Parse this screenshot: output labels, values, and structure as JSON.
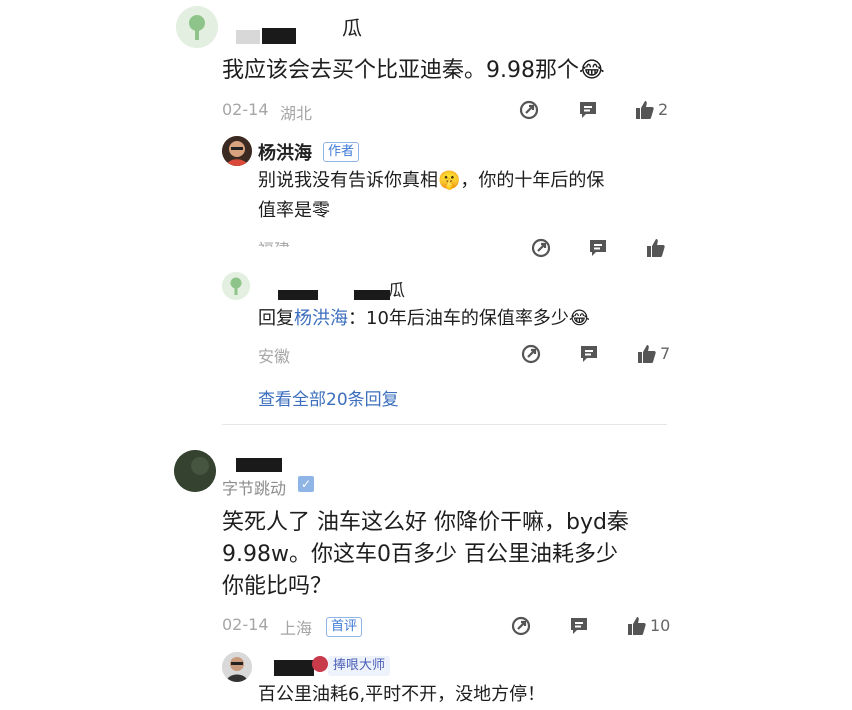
{
  "comments": [
    {
      "name_tail": "瓜",
      "text": "我应该会去买个比亚迪秦。9.98那个😂",
      "date": "02-14",
      "location": "湖北",
      "likes": "2",
      "replies": [
        {
          "name": "杨洪海",
          "badge": "作者",
          "text_line1": "别说我没有告诉你真相🤫，你的十年后的保",
          "text_line2": "值率是零",
          "location": "福建"
        },
        {
          "name_tail": "瓜",
          "reply_prefix": "回复",
          "reply_to": "杨洪海",
          "reply_text": "：10年后油车的保值率多少😂",
          "location": "安徽",
          "likes": "7"
        }
      ],
      "view_all": "查看全部20条回复"
    },
    {
      "org": "字节跳动",
      "verified_mark": "✓",
      "text_line1": "笑死人了 油车这么好 你降价干嘛，byd秦",
      "text_line2": "9.98w。你这车0百多少 百公里油耗多少",
      "text_line3": "你能比吗？",
      "date": "02-14",
      "location": "上海",
      "badge": "首评",
      "likes": "10",
      "reply": {
        "badge": "捧哏大师",
        "text": "百公里油耗6,平时不开，没地方停！"
      }
    }
  ],
  "icons": {
    "share": "share-icon",
    "comment": "comment-icon",
    "like": "thumbs-up-icon"
  },
  "colors": {
    "link": "#3c6fbd",
    "meta": "#a6a6a6",
    "badge": "#3e7ad6"
  }
}
